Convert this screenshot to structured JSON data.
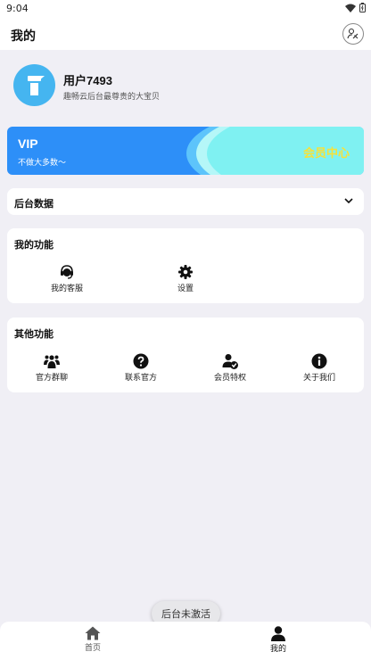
{
  "status_bar": {
    "time": "9:04"
  },
  "header": {
    "title": "我的",
    "action_icon": "edit-profile-icon"
  },
  "profile": {
    "username": "用户7493",
    "motto": "趣畅云后台最尊贵的大宝贝"
  },
  "vip": {
    "title": "VIP",
    "subtitle": "不做大多数～",
    "center_label": "会员中心",
    "colors": {
      "card": "#2d8ff8",
      "accent": "#f6e23a"
    }
  },
  "backend": {
    "label": "后台数据"
  },
  "my_functions": {
    "title": "我的功能",
    "items": [
      {
        "label": "我的客服",
        "icon": "customer-service-icon"
      },
      {
        "label": "设置",
        "icon": "gear-icon"
      }
    ]
  },
  "other_functions": {
    "title": "其他功能",
    "items": [
      {
        "label": "官方群聊",
        "icon": "group-chat-icon"
      },
      {
        "label": "联系官方",
        "icon": "help-icon"
      },
      {
        "label": "会员特权",
        "icon": "vip-user-icon"
      },
      {
        "label": "关于我们",
        "icon": "info-icon"
      }
    ]
  },
  "toast": {
    "text": "后台未激活"
  },
  "bottom_nav": {
    "items": [
      {
        "label": "首页",
        "icon": "home-icon",
        "active": false
      },
      {
        "label": "我的",
        "icon": "user-icon",
        "active": true
      }
    ]
  }
}
